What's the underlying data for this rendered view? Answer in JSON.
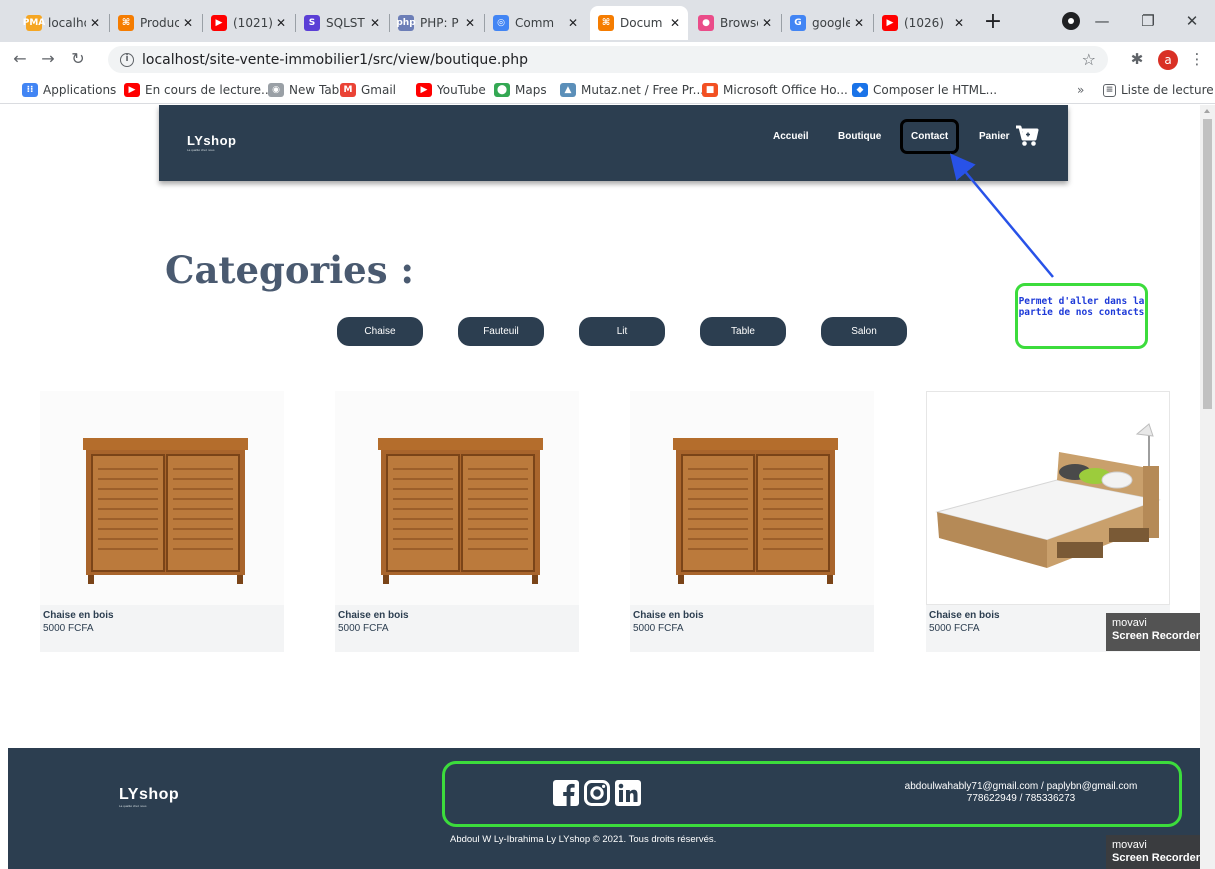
{
  "browser": {
    "tabs": [
      {
        "title": "localho",
        "color": "#f5a623",
        "glyph": "PMA"
      },
      {
        "title": "Produc",
        "color": "#f57c00",
        "glyph": "⌘"
      },
      {
        "title": "(1021)",
        "color": "#ff0000",
        "glyph": "▶"
      },
      {
        "title": "SQLST",
        "color": "#5b3fd6",
        "glyph": "S"
      },
      {
        "title": "PHP: P",
        "color": "#6c7eb7",
        "glyph": "php"
      },
      {
        "title": "Comm",
        "color": "#4285f4",
        "glyph": "◎"
      },
      {
        "title": "Docum",
        "color": "#f57c00",
        "glyph": "⌘"
      },
      {
        "title": "Browse",
        "color": "#ea4c89",
        "glyph": "●"
      },
      {
        "title": "google",
        "color": "#4285f4",
        "glyph": "G"
      },
      {
        "title": "(1026)",
        "color": "#ff0000",
        "glyph": "▶"
      }
    ],
    "url": "localhost/site-vente-immobilier1/src/view/boutique.php",
    "bookmarks": [
      {
        "label": "Applications",
        "color": "#4285f4",
        "glyph": "⁝⁝"
      },
      {
        "label": "En cours de lecture...",
        "color": "#ff0000",
        "glyph": "▶"
      },
      {
        "label": "New Tab",
        "color": "#9aa0a6",
        "glyph": "◉"
      },
      {
        "label": "Gmail",
        "color": "#ea4335",
        "glyph": "M"
      },
      {
        "label": "YouTube",
        "color": "#ff0000",
        "glyph": "▶"
      },
      {
        "label": "Maps",
        "color": "#34a853",
        "glyph": "⬤"
      },
      {
        "label": "Mutaz.net / Free Pr...",
        "color": "#5b8fb9",
        "glyph": "▲"
      },
      {
        "label": "Microsoft Office Ho...",
        "color": "#f25022",
        "glyph": "■"
      },
      {
        "label": "Composer le HTML...",
        "color": "#1a73e8",
        "glyph": "◆"
      }
    ],
    "bookmarks_more": "»",
    "reading_list": "Liste de lecture"
  },
  "site": {
    "logo": "LYshop",
    "logo_tagline": "La qualité chez nous",
    "nav": {
      "home": "Accueil",
      "shop": "Boutique",
      "contact": "Contact",
      "cart": "Panier"
    },
    "categories_title": "Categories :",
    "categories": [
      "Chaise",
      "Fauteuil",
      "Lit",
      "Table",
      "Salon"
    ],
    "annotation": "Permet d'aller dans la partie de nos contacts",
    "products": [
      {
        "name": "Chaise en bois",
        "price": "5000 FCFA"
      },
      {
        "name": "Chaise en bois",
        "price": "5000 FCFA"
      },
      {
        "name": "Chaise en bois",
        "price": "5000 FCFA"
      },
      {
        "name": "Chaise en bois",
        "price": "5000 FCFA"
      }
    ],
    "watermark": {
      "line1": "movavi",
      "line2": "Screen Recorder"
    },
    "footer": {
      "logo": "LYshop",
      "logo_tagline": "La qualité chez nous",
      "emails": "abdoulwahably71@gmail.com / paplybn@gmail.com",
      "phones": "778622949 / 785336273",
      "copyright": "Abdoul W Ly-Ibrahima Ly LYshop © 2021. Tous droits réservés."
    }
  },
  "colors": {
    "header_bg": "#2c3e50",
    "annotation_green": "#3cdc3c",
    "annotation_blue": "#1e3ad8"
  }
}
